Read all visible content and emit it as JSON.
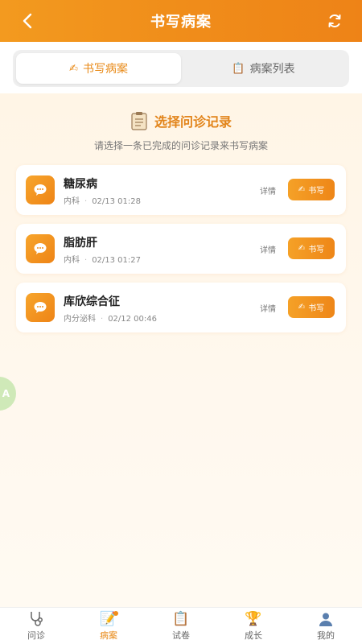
{
  "header": {
    "title": "书写病案",
    "back_icon": "chevron-left-icon",
    "refresh_icon": "refresh-icon"
  },
  "tabs": [
    {
      "label": "书写病案",
      "icon": "pencil-icon",
      "active": true
    },
    {
      "label": "病案列表",
      "icon": "clipboard-icon",
      "active": false
    }
  ],
  "section": {
    "title": "选择问诊记录",
    "subtitle": "请选择一条已完成的问诊记录来书写病案",
    "icon": "clipboard-icon"
  },
  "records": [
    {
      "name": "糖尿病",
      "dept": "内科",
      "time": "02/13 01:28",
      "detail_label": "详情",
      "write_label": "书写"
    },
    {
      "name": "脂肪肝",
      "dept": "内科",
      "time": "02/13 01:27",
      "detail_label": "详情",
      "write_label": "书写"
    },
    {
      "name": "库欣综合征",
      "dept": "内分泌科",
      "time": "02/12 00:46",
      "detail_label": "详情",
      "write_label": "书写"
    }
  ],
  "float_button": {
    "label": "A",
    "icon": "translate-icon"
  },
  "bottom_nav": [
    {
      "label": "问诊",
      "icon": "stethoscope-icon",
      "active": false
    },
    {
      "label": "病案",
      "icon": "notepad-icon",
      "active": true
    },
    {
      "label": "试卷",
      "icon": "clipboard-icon",
      "active": false
    },
    {
      "label": "成长",
      "icon": "trophy-icon",
      "active": false
    },
    {
      "label": "我的",
      "icon": "user-icon",
      "active": false
    }
  ],
  "colors": {
    "accent": "#f08d1a",
    "accent_text": "#e2841a",
    "background": "#fff7ea"
  }
}
